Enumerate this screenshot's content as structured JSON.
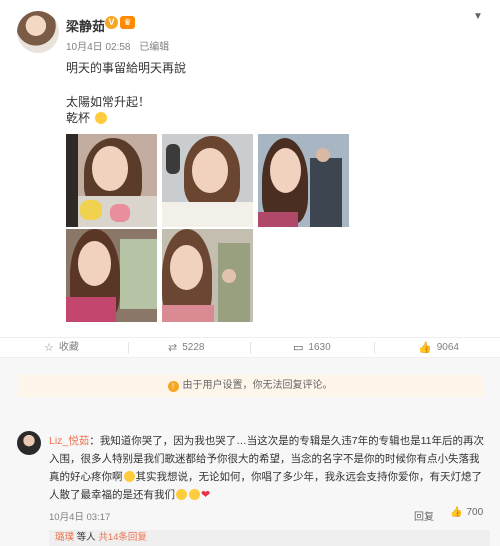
{
  "post": {
    "username": "梁静茹",
    "verify_icon": "V",
    "vip_icon": "vip-icon",
    "date": "10月4日 02:58",
    "edited": "已编辑",
    "line1": "明天的事留給明天再說",
    "line2": "太陽如常升起！",
    "line3": "乾杯",
    "emoji": "smile-emoji"
  },
  "photos": [
    {
      "name": "photo-1",
      "bg": "#b9a697"
    },
    {
      "name": "photo-2",
      "bg": "#c3c6c9"
    },
    {
      "name": "photo-3",
      "bg": "#9fb0bd"
    },
    {
      "name": "photo-4",
      "bg": "#7f6c5e"
    },
    {
      "name": "photo-5",
      "bg": "#b8b2a6"
    }
  ],
  "actions": {
    "favorite_label": "收藏",
    "repost_count": "5228",
    "comment_count": "1630",
    "like_count": "9064"
  },
  "notice": "由于用户设置，你无法回复评论。",
  "comment": {
    "user": "Liz_悦茹",
    "text_a": "：我知道你哭了，因为我也哭了…当这次是的专辑是久违7年的专辑也是11年后的再次入围，很多人特别是我们歌迷都给予你很大的希望，当念的名字不是你的时候你有点小失落我真的好心疼你啊",
    "text_b": "其实我想说，无论如何，你唱了多少年，我永远会支持你爱你，有天灯熄了人散了最幸福的是还有我们",
    "date": "10月4日 03:17",
    "reply_label": "回复",
    "likes": "700"
  },
  "sub_replies": {
    "user": "璐璞",
    "middle": "等人",
    "count_label": "共14条回复"
  },
  "colors": {
    "accent": "#eb7350",
    "notice_bg": "#fdf4ea",
    "page_bg": "#f7f7f7"
  }
}
